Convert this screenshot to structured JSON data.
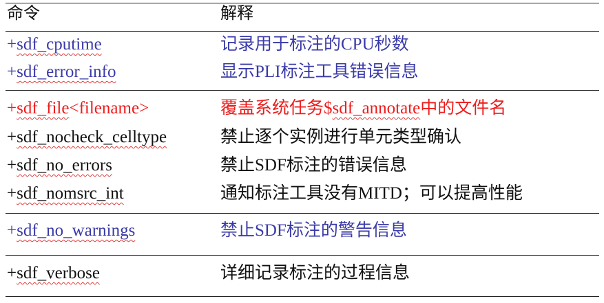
{
  "header": {
    "command": "命令",
    "description": "解释"
  },
  "colors": {
    "blue": "#3a3aa8",
    "red": "#ee1c1c",
    "black": "#111111",
    "spellcheck_underline": "#e23b3b"
  },
  "rows": [
    {
      "command_prefix": "+",
      "command_name": "sdf_cputime",
      "command_suffix": "",
      "description": "记录用于标注的CPU秒数"
    },
    {
      "command_prefix": "+",
      "command_name": "sdf_error_info",
      "command_suffix": "",
      "description": "显示PLI标注工具错误信息"
    },
    {
      "command_prefix": "+",
      "command_name": "sdf_file",
      "command_suffix": "<filename>",
      "description_before": "覆盖系统任务$",
      "description_underlined": "sdf_annotate",
      "description_after": "中的文件名"
    },
    {
      "command_prefix": "+",
      "command_name": "sdf_nocheck_celltype",
      "command_suffix": "",
      "description": "禁止逐个实例进行单元类型确认"
    },
    {
      "command_prefix": "+",
      "command_name": "sdf_no_errors",
      "command_suffix": "",
      "description": "禁止SDF标注的错误信息"
    },
    {
      "command_prefix": "+",
      "command_name": "sdf_nomsrc_int",
      "command_suffix": "",
      "description": "通知标注工具没有MITD；可以提高性能"
    },
    {
      "command_prefix": "+",
      "command_name": "sdf_no_warnings",
      "command_suffix": "",
      "description": "禁止SDF标注的警告信息"
    },
    {
      "command_prefix": "+",
      "command_name": "sdf_verbose",
      "command_suffix": "",
      "description": "详细记录标注的过程信息"
    }
  ]
}
